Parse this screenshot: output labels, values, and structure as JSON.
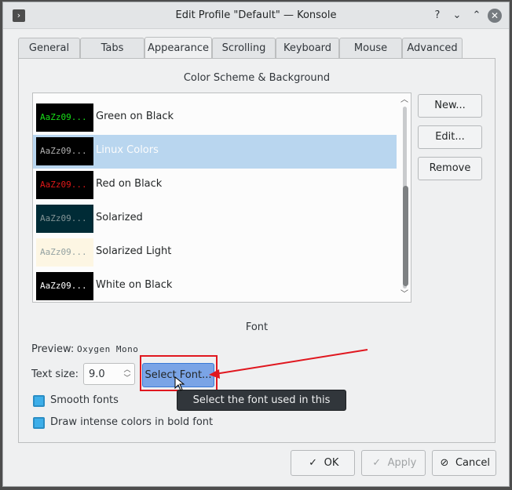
{
  "window": {
    "title": "Edit Profile \"Default\" — Konsole",
    "controls": {
      "help": "?",
      "minimize": "⌄",
      "maximize": "⌃",
      "close": "✕"
    }
  },
  "tabs": [
    {
      "label": "General",
      "active": false
    },
    {
      "label": "Tabs",
      "active": false
    },
    {
      "label": "Appearance",
      "active": true
    },
    {
      "label": "Scrolling",
      "active": false
    },
    {
      "label": "Keyboard",
      "active": false
    },
    {
      "label": "Mouse",
      "active": false
    },
    {
      "label": "Advanced",
      "active": false
    }
  ],
  "color_scheme": {
    "section_title": "Color Scheme & Background",
    "schemes": [
      {
        "name": "Green on Black",
        "preview": "AaZz09...",
        "bg": "#000000",
        "fg": "#18e018",
        "selected": false
      },
      {
        "name": "Linux Colors",
        "preview": "AaZz09...",
        "bg": "#000000",
        "fg": "#b2b2b2",
        "selected": true
      },
      {
        "name": "Red on Black",
        "preview": "AaZz09...",
        "bg": "#000000",
        "fg": "#e01818",
        "selected": false
      },
      {
        "name": "Solarized",
        "preview": "AaZz09...",
        "bg": "#002b36",
        "fg": "#839496",
        "selected": false
      },
      {
        "name": "Solarized Light",
        "preview": "AaZz09...",
        "bg": "#fdf6e3",
        "fg": "#93a1a1",
        "selected": false
      },
      {
        "name": "White on Black",
        "preview": "AaZz09...",
        "bg": "#000000",
        "fg": "#ffffff",
        "selected": false
      }
    ],
    "buttons": {
      "new": "New...",
      "edit": "Edit...",
      "remove": "Remove"
    }
  },
  "font": {
    "section_title": "Font",
    "preview_label": "Preview:",
    "preview_value": "Oxygen Mono",
    "text_size_label": "Text size:",
    "text_size_value": "9.0",
    "select_font_button": "Select Font...",
    "smooth_fonts": {
      "label": "Smooth fonts",
      "checked": true
    },
    "intense_bold": {
      "label": "Draw intense colors in bold font",
      "checked": true
    },
    "tooltip": "Select the font used in this profile"
  },
  "footer": {
    "ok": "OK",
    "apply": "Apply",
    "cancel": "Cancel"
  },
  "colors": {
    "selection": "#b9d6ef",
    "accent": "#3daee9",
    "annotation_red": "#e0171f"
  }
}
